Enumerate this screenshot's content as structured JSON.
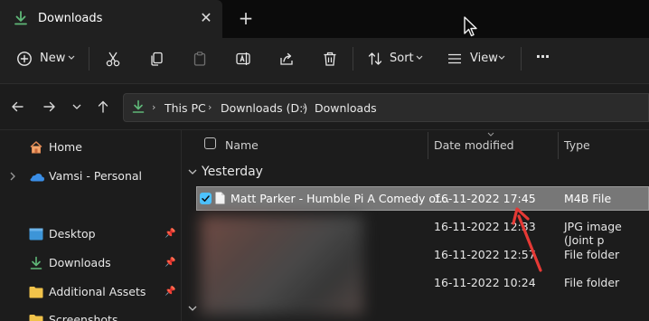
{
  "window": {
    "tab_title": "Downloads",
    "close_symbol": "✕",
    "new_tab_symbol": "+"
  },
  "toolbar": {
    "new_label": "New",
    "sort_label": "Sort",
    "view_label": "View",
    "more_symbol": "···"
  },
  "address": {
    "crumbs": [
      "This PC",
      "Downloads (D:)",
      "Downloads"
    ]
  },
  "sidebar": {
    "items": [
      {
        "label": "Home",
        "icon": "home-icon"
      },
      {
        "label": "Vamsi - Personal",
        "icon": "onedrive-cloud-icon"
      },
      {
        "label": "Desktop",
        "icon": "desktop-icon"
      },
      {
        "label": "Downloads",
        "icon": "download-icon"
      },
      {
        "label": "Additional Assets",
        "icon": "folder-icon"
      },
      {
        "label": "Screenshots",
        "icon": "folder-icon"
      }
    ]
  },
  "columns": {
    "name": "Name",
    "date_modified": "Date modified",
    "type": "Type"
  },
  "groups": {
    "yesterday": "Yesterday"
  },
  "files": [
    {
      "name": "Matt Parker - Humble Pi A Comedy of...",
      "date": "16-11-2022 17:45",
      "type": "M4B File",
      "selected": true
    },
    {
      "name": "",
      "date": "16-11-2022 12:33",
      "type": "JPG image (Joint p",
      "selected": false
    },
    {
      "name": "",
      "date": "16-11-2022 12:57",
      "type": "File folder",
      "selected": false
    },
    {
      "name": "",
      "date": "16-11-2022 10:24",
      "type": "File folder",
      "selected": false
    }
  ],
  "colors": {
    "accent": "#4cc2ff",
    "download_green": "#5fb878",
    "folder_yellow": "#f0c24a",
    "arrow_red": "#e53935",
    "selection_gray": "#777777"
  }
}
